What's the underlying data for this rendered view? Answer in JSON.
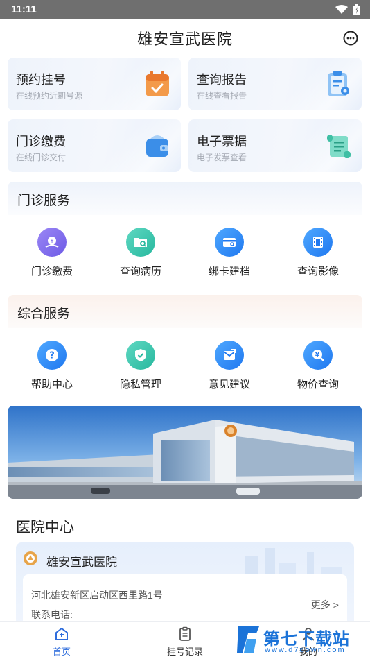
{
  "status_bar": {
    "time": "11:11"
  },
  "header": {
    "title": "雄安宣武医院"
  },
  "quick_cards": [
    {
      "title": "预约挂号",
      "subtitle": "在线预约近期号源",
      "icon": "calendar-icon"
    },
    {
      "title": "查询报告",
      "subtitle": "在线查看报告",
      "icon": "report-icon"
    },
    {
      "title": "门诊缴费",
      "subtitle": "在线门诊交付",
      "icon": "wallet-icon"
    },
    {
      "title": "电子票据",
      "subtitle": "电子发票查看",
      "icon": "scroll-icon"
    }
  ],
  "outpatient": {
    "title": "门诊服务",
    "items": [
      {
        "label": "门诊缴费",
        "icon": "payment-icon"
      },
      {
        "label": "查询病历",
        "icon": "folder-search-icon"
      },
      {
        "label": "绑卡建档",
        "icon": "card-icon"
      },
      {
        "label": "查询影像",
        "icon": "film-icon"
      }
    ]
  },
  "general": {
    "title": "综合服务",
    "items": [
      {
        "label": "帮助中心",
        "icon": "help-icon"
      },
      {
        "label": "隐私管理",
        "icon": "shield-icon"
      },
      {
        "label": "意见建议",
        "icon": "mail-icon"
      },
      {
        "label": "物价查询",
        "icon": "price-search-icon"
      }
    ]
  },
  "center": {
    "title": "医院中心",
    "hospital_name": "雄安宣武医院",
    "address": "河北雄安新区启动区西里路1号",
    "phone_label": "联系电话:",
    "more": "更多 >"
  },
  "bottom_nav": [
    {
      "label": "首页",
      "icon": "home-icon",
      "active": true
    },
    {
      "label": "挂号记录",
      "icon": "record-icon",
      "active": false
    },
    {
      "label": "我的",
      "icon": "user-icon",
      "active": false
    }
  ],
  "watermark": {
    "text": "第七下载站",
    "url": "www.d7down.com"
  },
  "colors": {
    "primary": "#2f6ddc",
    "orange": "#f08a3e",
    "teal": "#27b89e",
    "purple": "#6d5ae6"
  }
}
